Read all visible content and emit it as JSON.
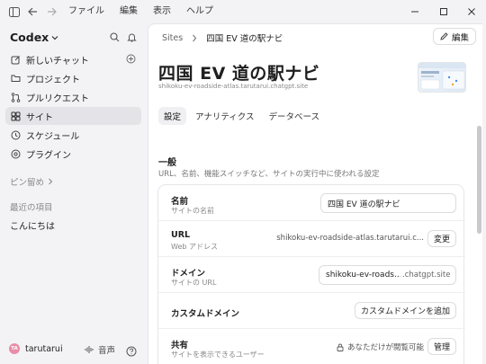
{
  "titlebar": {
    "menu": [
      "ファイル",
      "編集",
      "表示",
      "ヘルプ"
    ]
  },
  "sidebar": {
    "brand": "Codex",
    "items": [
      {
        "label": "新しいチャット",
        "icon": "edit-icon"
      },
      {
        "label": "プロジェクト",
        "icon": "folder-icon"
      },
      {
        "label": "プルリクエスト",
        "icon": "pull-request-icon"
      },
      {
        "label": "サイト",
        "icon": "sites-icon",
        "active": true
      },
      {
        "label": "スケジュール",
        "icon": "clock-icon"
      },
      {
        "label": "プラグイン",
        "icon": "plugin-icon"
      }
    ],
    "pinned_label": "ピン留め",
    "recent_label": "最近の項目",
    "recent_items": [
      "こんにちは"
    ],
    "user": {
      "initials": "TA",
      "name": "tarutarui"
    },
    "voice_label": "音声"
  },
  "main": {
    "breadcrumb": {
      "parent": "Sites",
      "current": "四国 EV 道の駅ナビ"
    },
    "edit_label": "編集",
    "title": "四国 EV 道の駅ナビ",
    "subtitle": "shikoku-ev-roadside-atlas.tarutarui.chatgpt.site",
    "tabs": [
      "設定",
      "アナリティクス",
      "データベース"
    ],
    "section": {
      "title": "一般",
      "description": "URL、名前、機能スイッチなど、サイトの実行中に使われる設定"
    },
    "rows": {
      "name": {
        "label": "名前",
        "desc": "サイトの名前",
        "value": "四国 EV 道の駅ナビ"
      },
      "url": {
        "label": "URL",
        "desc": "Web アドレス",
        "value": "shikoku-ev-roadside-atlas.tarutarui.c...",
        "button": "変更"
      },
      "domain": {
        "label": "ドメイン",
        "desc": "サイトの URL",
        "value": "shikoku-ev-roads...",
        "suffix": ".chatgpt.site"
      },
      "custom_domain": {
        "label": "カスタムドメイン",
        "button": "カスタムドメインを追加"
      },
      "sharing": {
        "label": "共有",
        "desc": "サイトを表示できるユーザー",
        "value": "あなただけが閲覧可能",
        "button": "管理"
      }
    }
  }
}
